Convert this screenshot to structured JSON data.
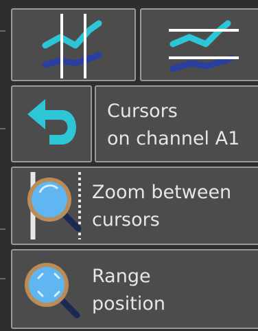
{
  "toolbar": {
    "vertical_cursors_icon": "vertical-cursors-chart-icon",
    "horizontal_cursors_icon": "horizontal-cursors-chart-icon",
    "undo_icon": "undo-arrow-icon",
    "cursor_channel": {
      "line1": "Cursors",
      "line2": "on channel A1"
    },
    "zoom_between": {
      "icon": "zoom-magnifier-cursors-icon",
      "line1": "Zoom between",
      "line2": "cursors"
    },
    "range_position": {
      "icon": "range-magnifier-icon",
      "line1": "Range",
      "line2": "position"
    }
  },
  "colors": {
    "button_bg": "#4c4c4c",
    "button_border": "#9a9a9a",
    "cyan": "#2ec6d6",
    "navy": "#2a3fa0",
    "text": "#e6e6e6",
    "lens": "#5fb6f0",
    "lens_rim": "#b98c5a"
  }
}
